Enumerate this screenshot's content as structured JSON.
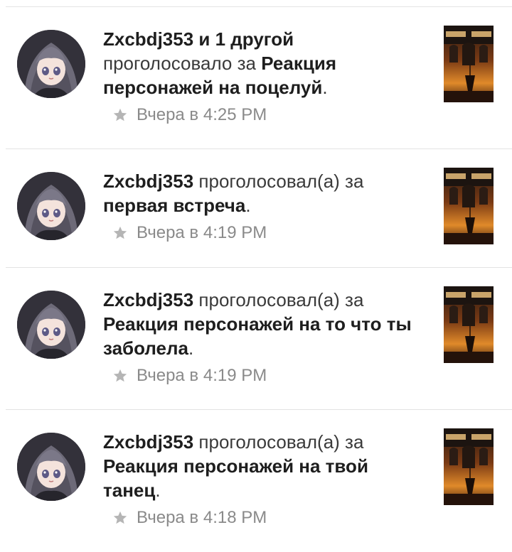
{
  "notifications": [
    {
      "actor": "Zxcbdj353 и 1 другой",
      "verb": "проголосовало за",
      "target": "Реакция персонажей на поцелуй",
      "time": "Вчера в 4:25 PM",
      "avatar_icon": "anime-avatar-icon",
      "poster_icon": "pirates-poster-icon"
    },
    {
      "actor": "Zxcbdj353",
      "verb": "проголосовал(а) за",
      "target": "первая встреча",
      "time": "Вчера в 4:19 PM",
      "avatar_icon": "anime-avatar-icon",
      "poster_icon": "pirates-poster-icon"
    },
    {
      "actor": "Zxcbdj353",
      "verb": "проголосовал(а) за",
      "target": "Реакция персонажей на то что ты заболела",
      "time": "Вчера в 4:19 PM",
      "avatar_icon": "anime-avatar-icon",
      "poster_icon": "pirates-poster-icon"
    },
    {
      "actor": "Zxcbdj353",
      "verb": "проголосовал(а) за",
      "target": "Реакция персонажей на твой танец",
      "time": "Вчера в 4:18 PM",
      "avatar_icon": "anime-avatar-icon",
      "poster_icon": "pirates-poster-icon"
    }
  ],
  "punctuation": ".",
  "colors": {
    "star": "#b5b5b5",
    "time_text": "#8a8a8a",
    "divider": "#e3e3e3"
  }
}
